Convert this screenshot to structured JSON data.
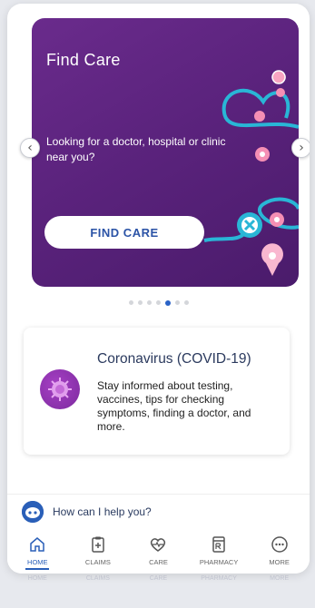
{
  "carousel": {
    "title": "Find Care",
    "description": "Looking for a doctor, hospital or clinic near you?",
    "button_label": "FIND CARE",
    "prev_glyph": "‹",
    "next_glyph": "›",
    "slide_count": 7,
    "active_slide": 5
  },
  "info_card": {
    "title": "Coronavirus (COVID-19)",
    "text": "Stay informed about testing, vaccines, tips for checking symptoms, finding a doctor, and more."
  },
  "help": {
    "prompt": "How can I help you?"
  },
  "nav": {
    "items": [
      {
        "label": "HOME",
        "icon": "home-icon",
        "active": true
      },
      {
        "label": "CLAIMS",
        "icon": "clipboard-icon",
        "active": false
      },
      {
        "label": "CARE",
        "icon": "heart-pulse-icon",
        "active": false
      },
      {
        "label": "PHARMACY",
        "icon": "prescription-icon",
        "active": false
      },
      {
        "label": "MORE",
        "icon": "more-icon",
        "active": false
      }
    ]
  },
  "colors": {
    "primary": "#2a5fb8",
    "card_purple": "#5b237d",
    "teal": "#29b6d6",
    "pin_pink": "#f7a4c1"
  }
}
